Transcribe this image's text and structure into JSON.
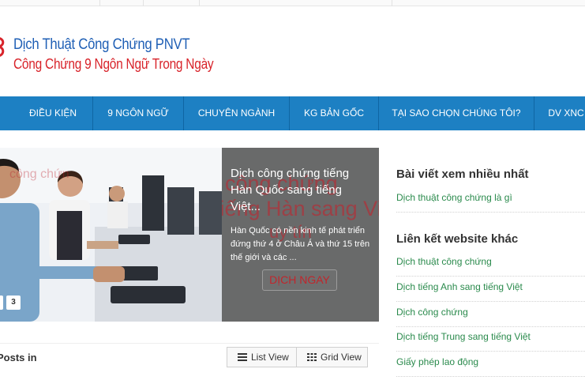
{
  "logo": {
    "title": "Dịch Thuật Công Chứng PNVT",
    "subtitle": "Công Chứng 9 Ngôn Ngữ Trong Ngày"
  },
  "nav": {
    "items": [
      {
        "label": "ĐIỀU KIỆN"
      },
      {
        "label": "9 NGÔN NGỮ"
      },
      {
        "label": "CHUYÊN NGÀNH"
      },
      {
        "label": "KG BẢN GỐC"
      },
      {
        "label": "TẠI SAO CHỌN CHÚNG TÔI?"
      },
      {
        "label": "DV XNC"
      }
    ]
  },
  "slider": {
    "title": "Dịch công chứng tiếng Hàn Quốc sang tiếng Việt...",
    "excerpt": "Hàn Quốc có nền kinh tế phát triển đứng thứ 4 ở Châu Á và thứ 15 trên thế giới và các ...",
    "button_label": "DỊCH NGAY",
    "pager": [
      "3"
    ]
  },
  "posts": {
    "label": "Posts in",
    "list_view_label": "List View",
    "grid_view_label": "Grid View"
  },
  "sidebar": {
    "popular_title": "Bài viết xem nhiều nhất",
    "popular_links": [
      "Dịch thuật công chứng là gì"
    ],
    "links_title": "Liên kết website khác",
    "links": [
      "Dịch thuật công chứng",
      "Dịch tiếng Anh sang tiếng Việt",
      "Dịch công chứng",
      "Dịch tiếng Trung sang tiếng Việt",
      "Giấy phép lao động"
    ]
  },
  "colors": {
    "nav_bg": "#1d80c3",
    "logo_blue": "#1f5fb5",
    "logo_red": "#d8232a",
    "link_green": "#2a8a4c",
    "caption_bg": "#5f5f5f"
  }
}
